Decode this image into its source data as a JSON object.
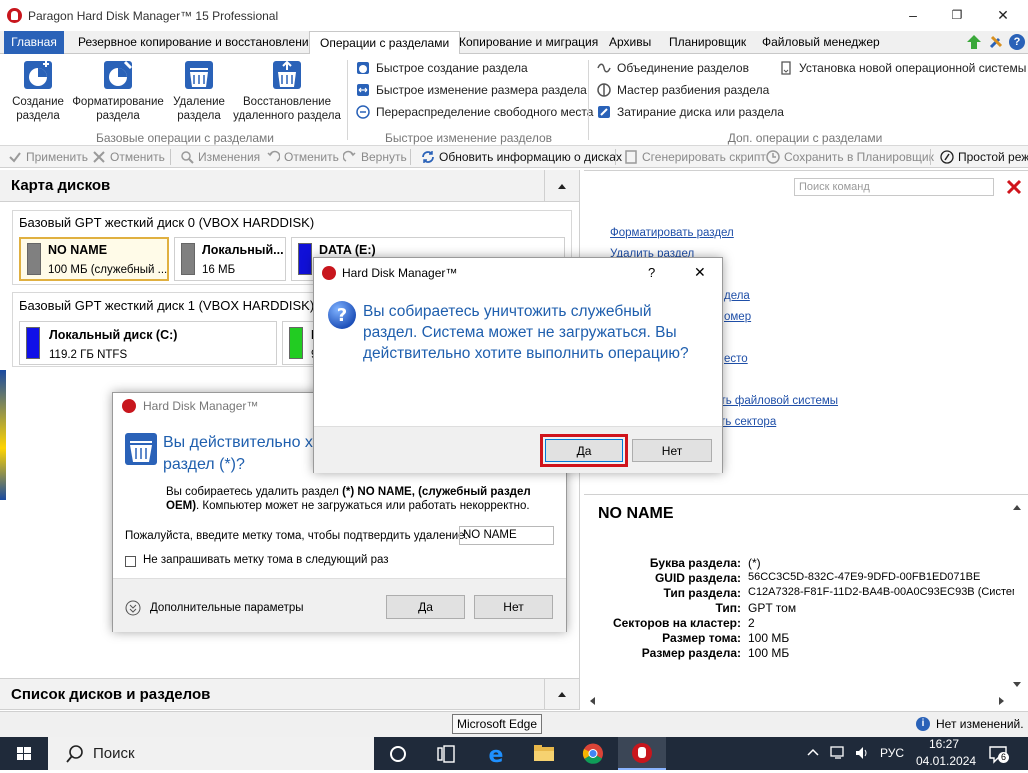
{
  "window": {
    "title": "Paragon Hard Disk Manager™ 15 Professional",
    "minimize": "–",
    "maximize": "❐",
    "close": "✕"
  },
  "menu": {
    "tabs": [
      "Главная",
      "Резервное копирование и восстановление",
      "Операции с разделами",
      "Копирование и миграция",
      "Архивы",
      "Планировщик",
      "Файловый менеджер"
    ],
    "active_index": 2
  },
  "ribbon": {
    "big_buttons": [
      {
        "label": "Создание\nраздела"
      },
      {
        "label": "Форматирование\nраздела"
      },
      {
        "label": "Удаление\nраздела"
      },
      {
        "label": "Восстановление\nудаленного раздела"
      }
    ],
    "group1_label": "Базовые операции с разделами",
    "group2": {
      "items": [
        "Быстрое создание раздела",
        "Быстрое изменение размера раздела",
        "Перераспределение свободного места"
      ],
      "label": "Быстрое изменение разделов"
    },
    "group3": {
      "items": [
        "Объединение разделов",
        "Мастер разбиения раздела",
        "Затирание диска или раздела",
        "Установка новой операционной системы"
      ],
      "label": "Доп. операции с разделами"
    }
  },
  "toolbar": {
    "items": [
      {
        "label": "Применить",
        "enabled": false
      },
      {
        "label": "Отменить",
        "enabled": false
      },
      {
        "label": "Изменения",
        "enabled": false
      },
      {
        "label": "Отменить",
        "enabled": false
      },
      {
        "label": "Вернуть",
        "enabled": false
      },
      {
        "label": "Обновить информацию о дисках",
        "enabled": true
      },
      {
        "label": "Сгенерировать скрипт",
        "enabled": false
      },
      {
        "label": "Сохранить в Планировщик",
        "enabled": false
      },
      {
        "label": "Простой режим",
        "enabled": true
      }
    ]
  },
  "disk_map": {
    "title": "Карта дисков",
    "disks": [
      {
        "title": "Базовый GPT жесткий диск 0 (VBOX HARDDISK)",
        "partitions": [
          {
            "name": "NO NAME",
            "size": "100 МБ  (служебный ...",
            "color": "#808080",
            "selected": true
          },
          {
            "name": "Локальный...",
            "size": "16 МБ",
            "color": "#808080"
          },
          {
            "name": "DATA (E:)",
            "size": "",
            "color": "#1010d8"
          }
        ]
      },
      {
        "title": "Базовый GPT жесткий диск 1 (VBOX HARDDISK)",
        "partitions": [
          {
            "name": "Локальный диск (C:)",
            "size": "119.2 ГБ NTFS",
            "color": "#1010e8"
          },
          {
            "name": "L",
            "size": "9",
            "color": "#22cc22"
          }
        ]
      }
    ]
  },
  "disk_list": {
    "title": "Список дисков и разделов"
  },
  "search": {
    "placeholder": "Поиск команд"
  },
  "right_links": [
    "Форматировать раздел",
    "Удалить раздел",
    "дела",
    "омер",
    "есто",
    "ить файловой системы",
    "ать сектора"
  ],
  "details": {
    "title": "NO NAME",
    "rows": [
      {
        "k": "Буква раздела:",
        "v": "(*)"
      },
      {
        "k": "GUID раздела:",
        "v": "56CC3C5D-832C-47E9-9DFD-00FB1ED071BE"
      },
      {
        "k": "Тип раздела:",
        "v": "C12A7328-F81F-11D2-BA4B-00A0C93EC93B (Системн"
      },
      {
        "k": "Тип:",
        "v": "GPT том"
      },
      {
        "k": "Секторов на кластер:",
        "v": "2"
      },
      {
        "k": "Размер тома:",
        "v": "100 МБ"
      },
      {
        "k": "Размер раздела:",
        "v": "100 МБ"
      }
    ]
  },
  "dialog_back": {
    "title": "Hard Disk Manager™",
    "heading_l1": "Вы действительно х",
    "heading_l2": "раздел (*)?",
    "msg_prefix": "Вы собираетесь удалить раздел ",
    "msg_bold": "(*) NO NAME, (служебный раздел OEM)",
    "msg_suffix": ". Компьютер может не загружаться или работать некорректно.",
    "confirm_label": "Пожалуйста, введите метку тома, чтобы подтвердить удаление:",
    "confirm_value": "NO NAME",
    "checkbox_label": "Не запрашивать метку тома в следующий раз",
    "more_label": "Дополнительные параметры",
    "yes": "Да",
    "no": "Нет"
  },
  "dialog_front": {
    "title": "Hard Disk Manager™",
    "help": "?",
    "close": "✕",
    "message": "Вы собираетесь уничтожить служебный раздел. Система может не загружаться. Вы действительно хотите выполнить операцию?",
    "yes": "Да",
    "no": "Нет"
  },
  "tooltip": {
    "text": "Microsoft Edge"
  },
  "status": {
    "text": "Нет изменений."
  },
  "taskbar": {
    "search_label": "Поиск",
    "lang": "РУС",
    "time": "16:27",
    "date": "04.01.2024",
    "notifications": "6"
  },
  "colors": {
    "accent": "#2a62b8",
    "link": "#1f4fa8",
    "highlight_red": "#d0141c"
  }
}
